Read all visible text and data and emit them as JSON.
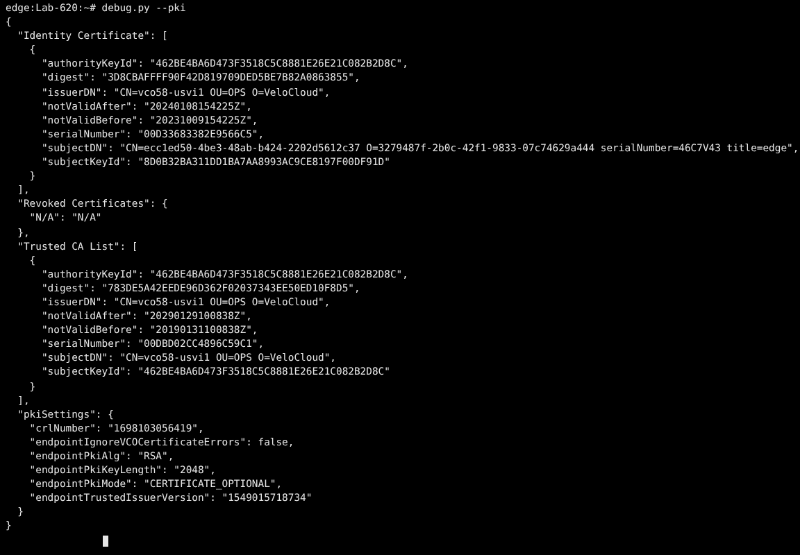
{
  "terminal": {
    "prompt": "edge:Lab-620:~# debug.py --pki",
    "output_lines": [
      "{",
      "  \"Identity Certificate\": [",
      "    {",
      "      \"authorityKeyId\": \"462BE4BA6D473F3518C5C8881E26E21C082B2D8C\",",
      "      \"digest\": \"3D8CBAFFFF90F42D819709DED5BE7B82A0863855\",",
      "      \"issuerDN\": \"CN=vco58-usvi1 OU=OPS O=VeloCloud\",",
      "      \"notValidAfter\": \"20240108154225Z\",",
      "      \"notValidBefore\": \"20231009154225Z\",",
      "      \"serialNumber\": \"00D33683382E9566C5\",",
      "      \"subjectDN\": \"CN=ecc1ed50-4be3-48ab-b424-2202d5612c37 O=3279487f-2b0c-42f1-9833-07c74629a444 serialNumber=46C7V43 title=edge\",",
      "      \"subjectKeyId\": \"8D0B32BA311DD1BA7AA8993AC9CE8197F00DF91D\"",
      "    }",
      "  ],",
      "  \"Revoked Certificates\": {",
      "    \"N/A\": \"N/A\"",
      "  },",
      "  \"Trusted CA List\": [",
      "    {",
      "      \"authorityKeyId\": \"462BE4BA6D473F3518C5C8881E26E21C082B2D8C\",",
      "      \"digest\": \"783DE5A42EEDE96D362F02037343EE50ED10F8D5\",",
      "      \"issuerDN\": \"CN=vco58-usvi1 OU=OPS O=VeloCloud\",",
      "      \"notValidAfter\": \"20290129100838Z\",",
      "      \"notValidBefore\": \"20190131100838Z\",",
      "      \"serialNumber\": \"00DBD02CC4896C59C1\",",
      "      \"subjectDN\": \"CN=vco58-usvi1 OU=OPS O=VeloCloud\",",
      "      \"subjectKeyId\": \"462BE4BA6D473F3518C5C8881E26E21C082B2D8C\"",
      "    }",
      "  ],",
      "  \"pkiSettings\": {",
      "    \"crlNumber\": \"1698103056419\",",
      "    \"endpointIgnoreVCOCertificateErrors\": false,",
      "    \"endpointPkiAlg\": \"RSA\",",
      "    \"endpointPkiKeyLength\": \"2048\",",
      "    \"endpointPkiMode\": \"CERTIFICATE_OPTIONAL\",",
      "    \"endpointTrustedIssuerVersion\": \"1549015718734\"",
      "  }",
      "}"
    ]
  }
}
